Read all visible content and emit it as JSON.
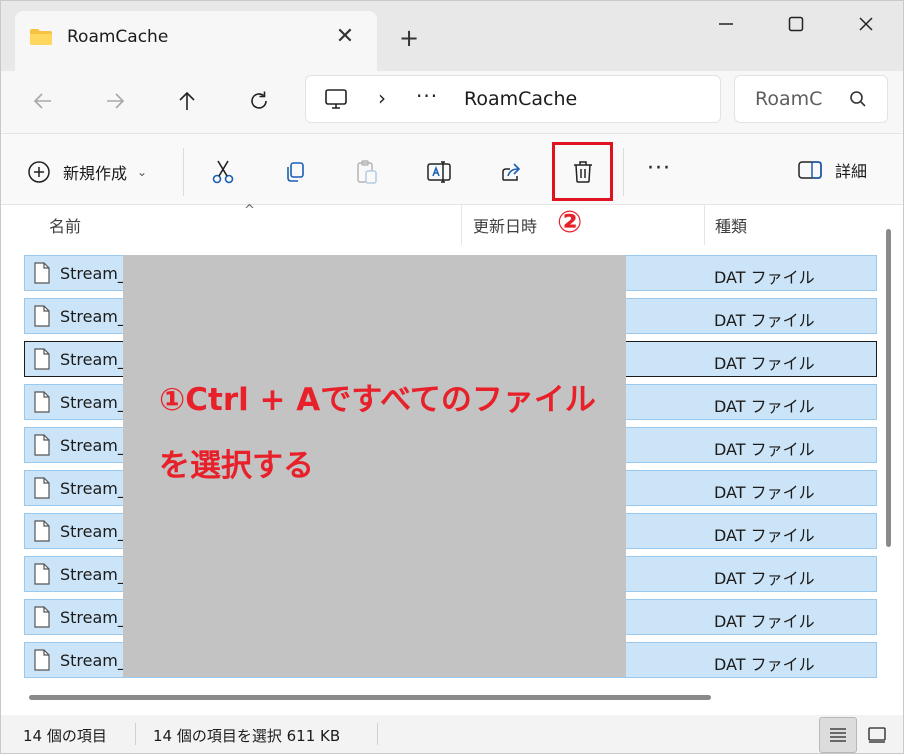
{
  "window": {
    "tab_title": "RoamCache",
    "close_tab": "✕",
    "new_tab": "+"
  },
  "nav": {
    "breadcrumb_sep": "›",
    "breadcrumb_more": "···",
    "path": "RoamCache",
    "search_placeholder": "RoamC"
  },
  "commands": {
    "new_label": "新規作成",
    "new_chevron": "⌄",
    "more": "···",
    "details_label": "詳細"
  },
  "columns": {
    "name": "名前",
    "date": "更新日時",
    "type": "種類",
    "sort_indicator": "^"
  },
  "files": [
    {
      "name": "Stream_",
      "type": "DAT ファイル"
    },
    {
      "name": "Stream_",
      "type": "DAT ファイル"
    },
    {
      "name": "Stream_",
      "type": "DAT ファイル"
    },
    {
      "name": "Stream_",
      "type": "DAT ファイル"
    },
    {
      "name": "Stream_",
      "type": "DAT ファイル"
    },
    {
      "name": "Stream_",
      "type": "DAT ファイル"
    },
    {
      "name": "Stream_",
      "type": "DAT ファイル"
    },
    {
      "name": "Stream_",
      "type": "DAT ファイル"
    },
    {
      "name": "Stream_",
      "type": "DAT ファイル"
    },
    {
      "name": "Stream_",
      "type": "DAT ファイル"
    }
  ],
  "annotations": {
    "step1_line1": "①Ctrl + Aですべてのファイル",
    "step1_line2": "を選択する",
    "step2": "②"
  },
  "status": {
    "item_count": "14 個の項目",
    "selected": "14 個の項目を選択  611 KB"
  },
  "colors": {
    "selection": "#cce4f7",
    "annotation_red": "#e8202a",
    "overlay_gray": "#c3c3c3"
  }
}
